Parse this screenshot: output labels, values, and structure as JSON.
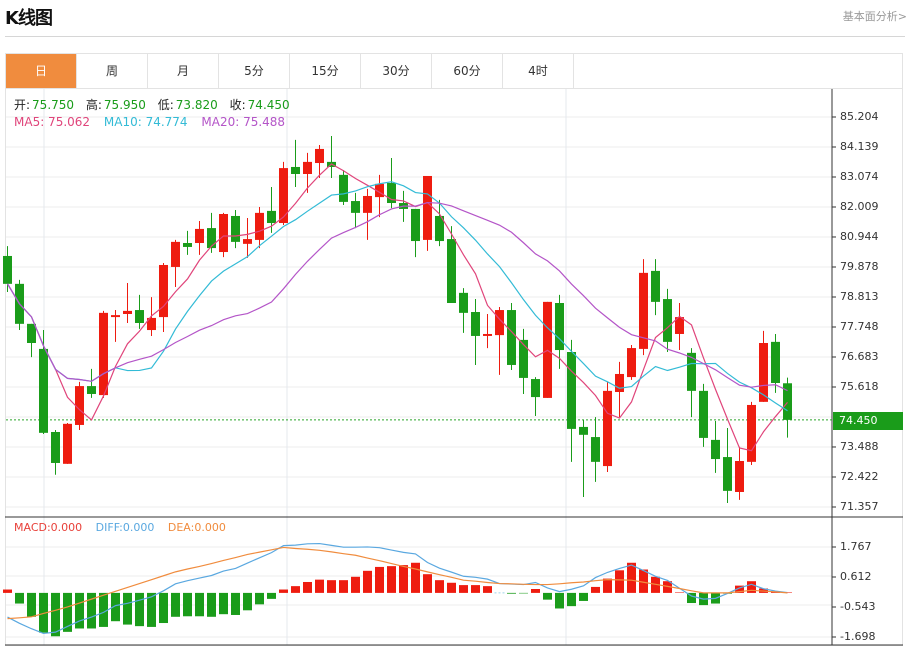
{
  "header": {
    "title": "K线图",
    "fundamental_link": "基本面分析>"
  },
  "tabs": [
    {
      "label": "日",
      "active": true
    },
    {
      "label": "周"
    },
    {
      "label": "月"
    },
    {
      "label": "5分"
    },
    {
      "label": "15分"
    },
    {
      "label": "30分"
    },
    {
      "label": "60分"
    },
    {
      "label": "4时"
    }
  ],
  "info": {
    "open_label": "开:",
    "open": "75.750",
    "high_label": "高:",
    "high": "75.950",
    "low_label": "低:",
    "low": "73.820",
    "close_label": "收:",
    "close": "74.450",
    "ma5": "MA5: 75.062",
    "ma10": "MA10: 74.774",
    "ma20": "MA20: 75.488"
  },
  "macd_info": {
    "macd": "MACD:0.000",
    "diff": "DIFF:0.000",
    "dea": "DEA:0.000"
  },
  "colors": {
    "up": "#ee1c10",
    "down": "#1a9c1a",
    "ma5": "#e0457b",
    "ma10": "#33bbd6",
    "ma20": "#b455c8",
    "diff": "#5aa8e0",
    "dea": "#f08c3e",
    "active_tab": "#f08c3e"
  },
  "chart_data": [
    {
      "type": "candlestick",
      "y_ticks": [
        "85.204",
        "84.139",
        "83.074",
        "82.009",
        "80.944",
        "79.878",
        "78.813",
        "77.748",
        "76.683",
        "75.618",
        "73.488",
        "72.422",
        "71.357"
      ],
      "ylim": [
        71.357,
        85.204
      ],
      "current_price": "74.450",
      "ohlc": [
        [
          80.27,
          80.62,
          78.99,
          79.28
        ],
        [
          79.28,
          79.42,
          77.64,
          77.86
        ],
        [
          77.86,
          77.86,
          76.68,
          77.18
        ],
        [
          76.97,
          77.64,
          73.95,
          73.99
        ],
        [
          74.02,
          74.09,
          72.5,
          72.92
        ],
        [
          72.89,
          74.34,
          72.89,
          74.31
        ],
        [
          74.27,
          75.8,
          74.09,
          75.65
        ],
        [
          75.65,
          76.26,
          75.23,
          75.37
        ],
        [
          75.33,
          78.32,
          75.23,
          78.25
        ],
        [
          78.1,
          78.35,
          77.22,
          78.17
        ],
        [
          78.21,
          79.31,
          77.89,
          78.32
        ],
        [
          78.35,
          78.89,
          77.68,
          77.89
        ],
        [
          77.64,
          78.81,
          77.43,
          78.07
        ],
        [
          78.1,
          80.02,
          77.57,
          79.95
        ],
        [
          79.88,
          80.84,
          79.17,
          80.77
        ],
        [
          80.73,
          81.16,
          80.31,
          80.59
        ],
        [
          80.73,
          81.51,
          80.31,
          81.23
        ],
        [
          81.26,
          81.8,
          80.38,
          80.55
        ],
        [
          80.41,
          81.8,
          80.23,
          81.76
        ],
        [
          81.69,
          81.9,
          80.55,
          80.77
        ],
        [
          80.7,
          81.62,
          80.2,
          80.87
        ],
        [
          80.84,
          82.01,
          80.55,
          81.8
        ],
        [
          81.87,
          82.72,
          81.09,
          81.44
        ],
        [
          81.44,
          83.61,
          81.37,
          83.39
        ],
        [
          83.43,
          84.39,
          82.72,
          83.18
        ],
        [
          83.18,
          83.93,
          82.51,
          83.61
        ],
        [
          83.57,
          84.21,
          83.04,
          84.07
        ],
        [
          83.61,
          84.53,
          83.04,
          83.43
        ],
        [
          83.15,
          83.32,
          82.08,
          82.19
        ],
        [
          82.22,
          82.51,
          81.26,
          81.8
        ],
        [
          81.8,
          82.65,
          80.84,
          82.4
        ],
        [
          82.36,
          83.15,
          81.65,
          82.83
        ],
        [
          82.86,
          83.75,
          81.97,
          82.15
        ],
        [
          82.15,
          82.58,
          81.48,
          81.94
        ],
        [
          81.94,
          81.94,
          80.23,
          80.8
        ],
        [
          80.84,
          83.11,
          80.45,
          83.11
        ],
        [
          81.69,
          82.26,
          80.62,
          80.8
        ],
        [
          80.87,
          81.33,
          78.6,
          78.6
        ],
        [
          78.96,
          79.13,
          77.54,
          78.25
        ],
        [
          78.28,
          78.74,
          76.4,
          77.43
        ],
        [
          77.43,
          78.21,
          77.0,
          77.5
        ],
        [
          77.46,
          78.46,
          76.05,
          78.35
        ],
        [
          78.35,
          78.6,
          76.22,
          76.4
        ],
        [
          77.29,
          77.68,
          75.37,
          75.94
        ],
        [
          75.9,
          75.97,
          74.59,
          75.26
        ],
        [
          75.23,
          78.64,
          75.23,
          78.64
        ],
        [
          78.6,
          78.89,
          76.26,
          76.93
        ],
        [
          76.86,
          77.29,
          72.96,
          74.13
        ],
        [
          74.2,
          74.45,
          71.71,
          73.92
        ],
        [
          73.84,
          74.55,
          72.25,
          72.96
        ],
        [
          72.81,
          75.8,
          72.6,
          75.48
        ],
        [
          75.44,
          76.51,
          74.55,
          76.08
        ],
        [
          75.97,
          77.11,
          75.87,
          77.0
        ],
        [
          76.97,
          80.16,
          76.75,
          79.67
        ],
        [
          79.74,
          80.16,
          78.17,
          78.64
        ],
        [
          78.74,
          79.1,
          76.86,
          77.22
        ],
        [
          77.5,
          78.6,
          76.93,
          78.1
        ],
        [
          76.83,
          77.0,
          74.55,
          75.48
        ],
        [
          75.48,
          75.73,
          73.49,
          73.81
        ],
        [
          73.74,
          74.41,
          72.57,
          73.06
        ],
        [
          73.13,
          74.16,
          71.5,
          71.93
        ],
        [
          71.89,
          73.49,
          71.61,
          72.99
        ],
        [
          72.96,
          75.09,
          72.85,
          74.98
        ],
        [
          75.09,
          77.61,
          75.09,
          77.18
        ],
        [
          77.22,
          77.5,
          75.41,
          75.76
        ],
        [
          75.75,
          75.95,
          73.82,
          74.45
        ]
      ],
      "series": [
        {
          "name": "MA5",
          "window": 5
        },
        {
          "name": "MA10",
          "window": 10
        },
        {
          "name": "MA20",
          "window": 20
        }
      ]
    },
    {
      "type": "bar+line",
      "y_ticks": [
        "1.767",
        "0.612",
        "-0.543",
        "-1.698"
      ],
      "ylim": [
        -1.9,
        2.2
      ],
      "macd": [
        0.13,
        -0.41,
        -0.92,
        -1.53,
        -1.67,
        -1.5,
        -1.37,
        -1.37,
        -1.31,
        -1.09,
        -1.22,
        -1.28,
        -1.31,
        -1.16,
        -0.92,
        -0.9,
        -0.9,
        -0.92,
        -0.82,
        -0.85,
        -0.67,
        -0.44,
        -0.23,
        0.13,
        0.26,
        0.42,
        0.51,
        0.49,
        0.49,
        0.62,
        0.85,
        1.0,
        1.03,
        1.07,
        1.16,
        0.72,
        0.49,
        0.39,
        0.3,
        0.3,
        0.26,
        0,
        -0.03,
        -0.02,
        0.15,
        -0.26,
        -0.6,
        -0.51,
        -0.31,
        0.23,
        0.55,
        0.87,
        1.16,
        0.9,
        0.62,
        0.45,
        0.02,
        -0.39,
        -0.47,
        -0.41,
        -0.03,
        0.28,
        0.45,
        0.17,
        0.05,
        0.02
      ],
      "diff": [
        -0.93,
        -1.17,
        -1.38,
        -1.56,
        -1.51,
        -1.29,
        -1.08,
        -0.93,
        -0.75,
        -0.49,
        -0.4,
        -0.28,
        -0.15,
        0.08,
        0.35,
        0.47,
        0.57,
        0.67,
        0.84,
        0.94,
        1.15,
        1.35,
        1.55,
        1.82,
        1.84,
        1.89,
        1.9,
        1.83,
        1.76,
        1.76,
        1.77,
        1.74,
        1.65,
        1.56,
        1.5,
        1.17,
        0.95,
        0.8,
        0.64,
        0.6,
        0.53,
        0.36,
        0.34,
        0.32,
        0.4,
        0.19,
        0.05,
        0.14,
        0.27,
        0.59,
        0.79,
        0.94,
        1.07,
        0.86,
        0.64,
        0.48,
        0.18,
        -0.12,
        -0.24,
        -0.21,
        -0.02,
        0.19,
        0.33,
        0.16,
        0.07,
        0.01
      ],
      "dea": [
        -0.99,
        -0.96,
        -0.92,
        -0.79,
        -0.67,
        -0.54,
        -0.39,
        -0.24,
        -0.09,
        0.06,
        0.21,
        0.36,
        0.51,
        0.66,
        0.81,
        0.92,
        1.02,
        1.13,
        1.25,
        1.36,
        1.48,
        1.57,
        1.66,
        1.75,
        1.71,
        1.68,
        1.64,
        1.58,
        1.51,
        1.45,
        1.34,
        1.24,
        1.13,
        1.02,
        0.92,
        0.81,
        0.7,
        0.6,
        0.49,
        0.45,
        0.4,
        0.36,
        0.35,
        0.33,
        0.32,
        0.32,
        0.35,
        0.39,
        0.42,
        0.47,
        0.51,
        0.5,
        0.49,
        0.41,
        0.33,
        0.25,
        0.17,
        0.08,
        0.0,
        0.0,
        0.0,
        0.05,
        0.1,
        0.07,
        0.04,
        0.0
      ]
    }
  ]
}
